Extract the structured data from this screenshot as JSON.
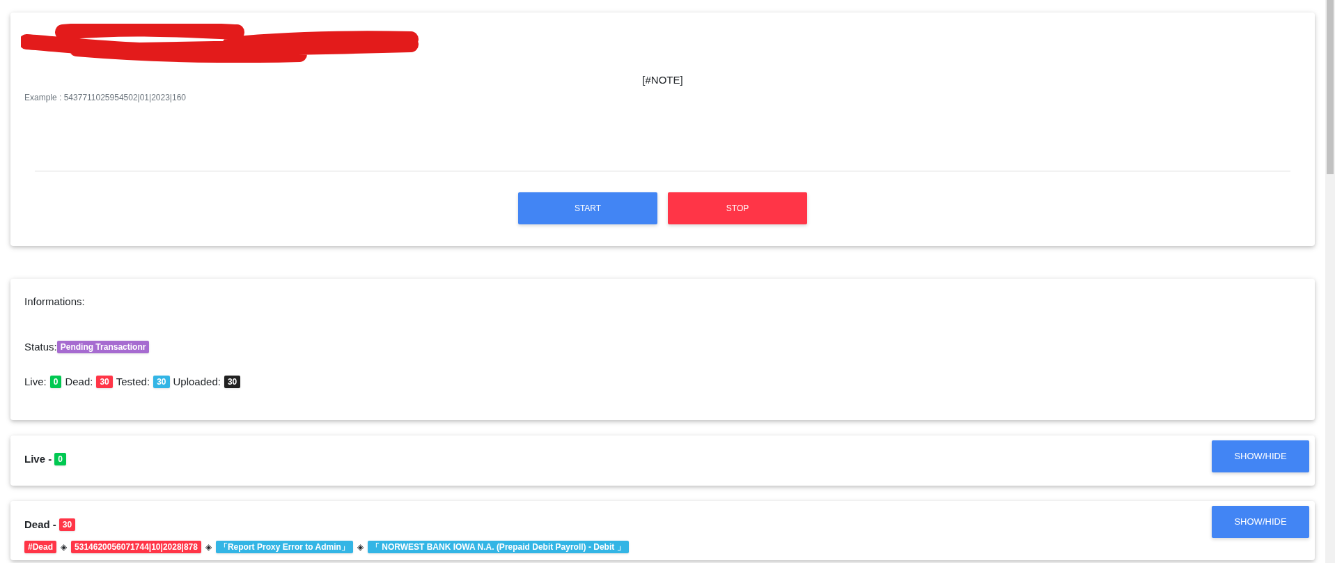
{
  "form": {
    "note": "[#NOTE]",
    "example": "Example : 5437711025954502|01|2023|160"
  },
  "buttons": [
    {
      "label": "START",
      "kind": "start"
    },
    {
      "label": "STOP",
      "kind": "stop"
    }
  ],
  "info": {
    "title": "Informations:",
    "status_label": "Status:",
    "status": {
      "text": "Pending Transactionr",
      "color": "#a66bd0"
    },
    "counters": [
      {
        "label": "Live:",
        "value": "0",
        "color": "#00c851"
      },
      {
        "label": "Dead:",
        "value": "30",
        "color": "#ff3547"
      },
      {
        "label": "Tested:",
        "value": "30",
        "color": "#33b5e5"
      },
      {
        "label": "Uploaded:",
        "value": "30",
        "color": "#212121"
      }
    ]
  },
  "panels": [
    {
      "title": "Live -",
      "count": "0",
      "color": "#00c851",
      "button": "SHOW/HIDE"
    },
    {
      "title": "Dead -",
      "count": "30",
      "color": "#ff3547",
      "button": "SHOW/HIDE",
      "results": [
        {
          "separator": "◈",
          "tags": [
            {
              "text": "#Dead",
              "color": "#ff3547"
            },
            {
              "text": "5314620056071744|10|2028|878",
              "color": "#ff3547"
            },
            {
              "text": "「Report Proxy Error to Admin」",
              "color": "#33b5e5"
            },
            {
              "text": "「 NORWEST BANK IOWA N.A. (Prepaid Debit Payroll) - Debit 」",
              "color": "#33b5e5"
            }
          ]
        }
      ]
    }
  ]
}
